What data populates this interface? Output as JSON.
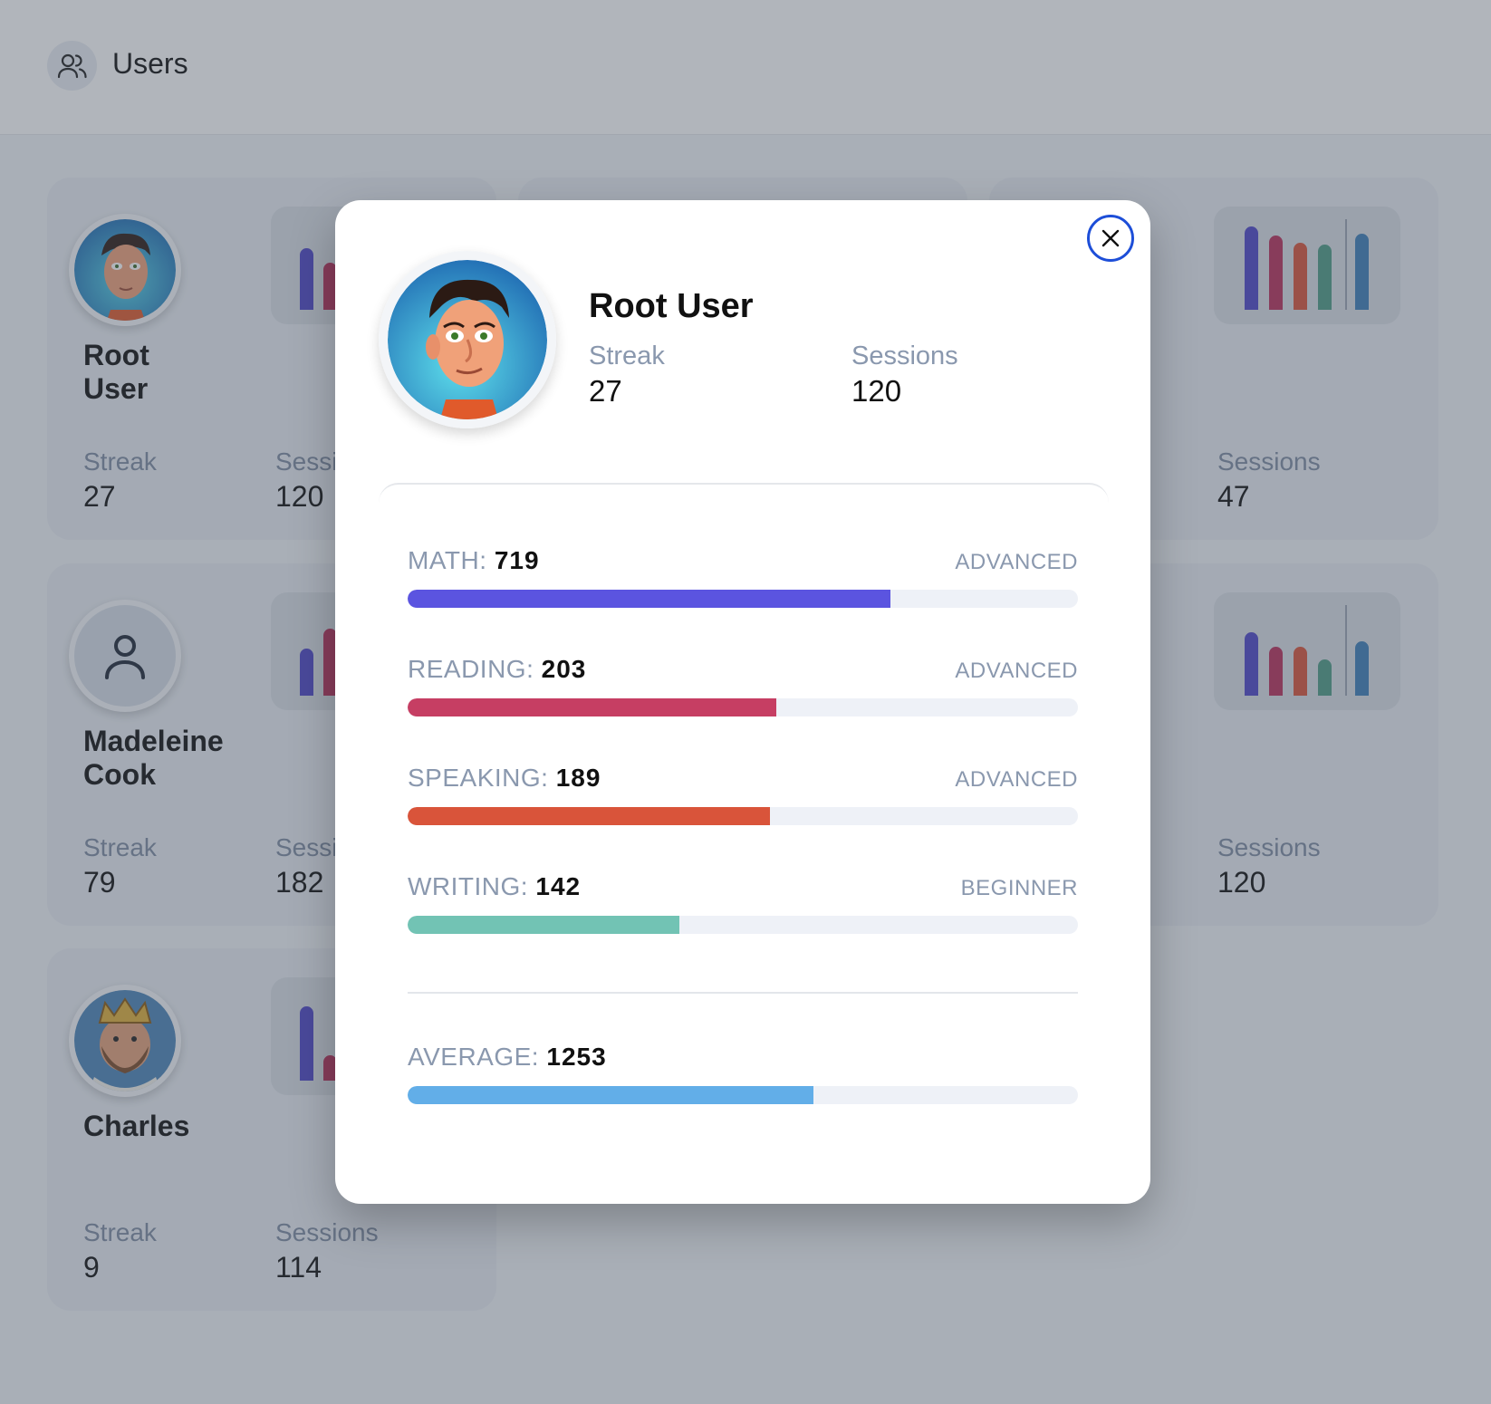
{
  "header": {
    "title": "Users",
    "icon": "users-icon"
  },
  "cards": [
    {
      "name_line1": "Root",
      "name_line2": "User",
      "streak_label": "Streak",
      "streak": "27",
      "sessions_label": "Sessi",
      "sessions": "120"
    },
    {
      "name_line1": "Madeleine",
      "name_line2": "Cook",
      "streak_label": "Streak",
      "streak": "79",
      "sessions_label": "Sessi",
      "sessions": "182"
    },
    {
      "name_line1": "Charles",
      "name_line2": "",
      "streak_label": "Streak",
      "streak": "9",
      "sessions_label": "Sessions",
      "sessions": "114"
    },
    {
      "sessions_label": "Sessions",
      "sessions": "47"
    },
    {
      "sessions_label": "Sessions",
      "sessions": "120"
    }
  ],
  "modal": {
    "name": "Root User",
    "streak_label": "Streak",
    "streak": "27",
    "sessions_label": "Sessions",
    "sessions": "120",
    "skills": [
      {
        "label": "MATH:",
        "score": "719",
        "level": "ADVANCED",
        "progress": 0.72,
        "color": "#5b54e0"
      },
      {
        "label": "READING:",
        "score": "203",
        "level": "ADVANCED",
        "progress": 0.55,
        "color": "#c63e63"
      },
      {
        "label": "SPEAKING:",
        "score": "189",
        "level": "ADVANCED",
        "progress": 0.54,
        "color": "#d9543a"
      },
      {
        "label": "WRITING:",
        "score": "142",
        "level": "BEGINNER",
        "progress": 0.405,
        "color": "#72c3b4"
      }
    ],
    "average": {
      "label": "AVERAGE:",
      "score": "1253",
      "progress": 0.605,
      "color": "#62aee8"
    }
  },
  "colors": {
    "accent": "#1d4ed8",
    "overlay": "rgba(70,78,92,0.42)"
  }
}
